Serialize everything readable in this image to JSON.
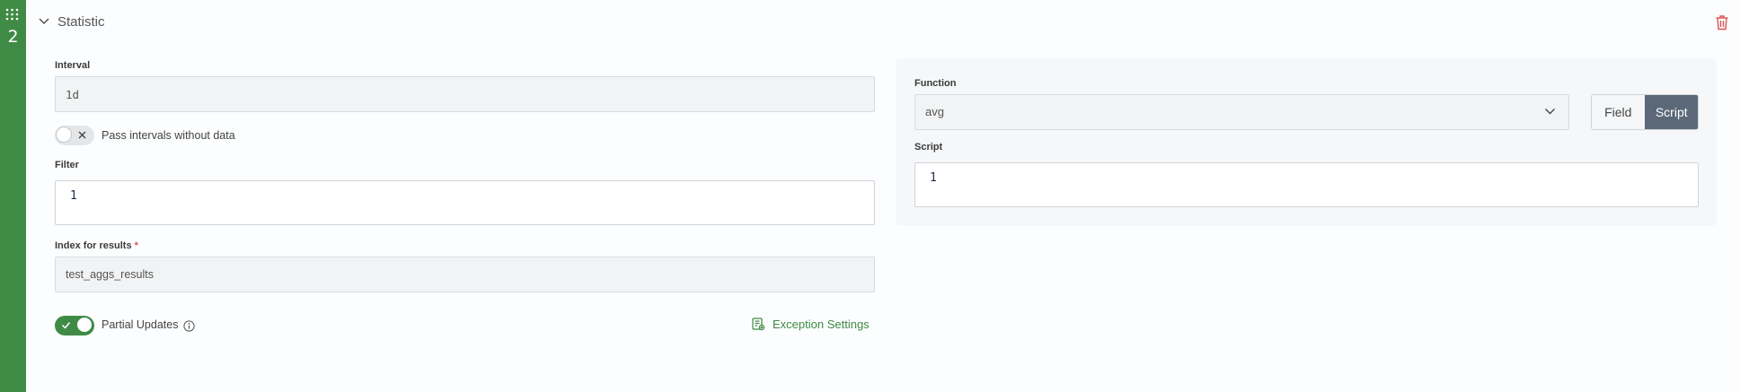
{
  "step": {
    "number": "2"
  },
  "section": {
    "title": "Statistic"
  },
  "left": {
    "interval": {
      "label": "Interval",
      "value": "1d"
    },
    "pass_intervals": {
      "label": "Pass intervals without data",
      "enabled": false
    },
    "filter": {
      "label": "Filter",
      "line_number": "1"
    },
    "index": {
      "label": "Index for results",
      "required_mark": "*",
      "value": "test_aggs_results"
    },
    "partial_updates": {
      "label": "Partial Updates",
      "enabled": true
    },
    "exception_settings": {
      "label": "Exception Settings"
    }
  },
  "right": {
    "function": {
      "label": "Function",
      "value": "avg"
    },
    "mode": {
      "options": [
        "Field",
        "Script"
      ],
      "selected": "Script"
    },
    "script": {
      "label": "Script",
      "line_number": "1"
    }
  },
  "colors": {
    "accent": "#3f8b46",
    "segment_selected": "#5a6878",
    "danger": "#d9534f"
  }
}
